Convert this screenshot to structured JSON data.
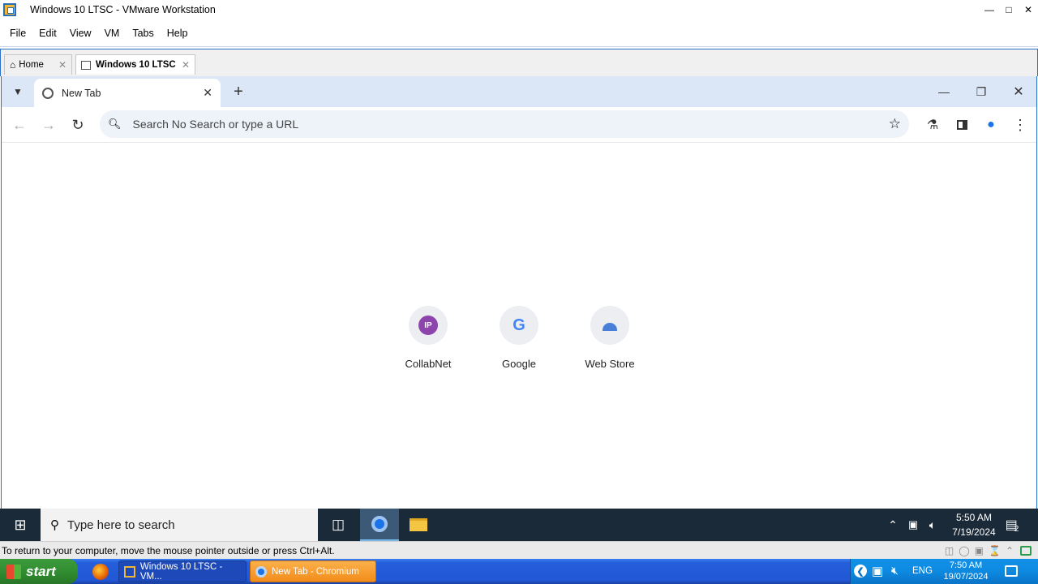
{
  "vmware": {
    "title": "Windows 10 LTSC - VMware Workstation",
    "menu": [
      "File",
      "Edit",
      "View",
      "VM",
      "Tabs",
      "Help"
    ],
    "tabs": [
      {
        "label": "Home"
      },
      {
        "label": "Windows 10 LTSC"
      }
    ],
    "status_text": "To return to your computer, move the mouse pointer outside or press Ctrl+Alt."
  },
  "chromium": {
    "tab_label": "New Tab",
    "omnibox_placeholder": "Search No Search or type a URL",
    "shortcuts": [
      {
        "name": "CollabNet",
        "badge": "IP",
        "badge_color": "#8e44ad"
      },
      {
        "name": "Google",
        "badge": "G"
      },
      {
        "name": "Web Store"
      }
    ]
  },
  "win10_taskbar": {
    "search_placeholder": "Type here to search",
    "time": "5:50 AM",
    "date": "7/19/2024",
    "notification_count": "2"
  },
  "xp_taskbar": {
    "start_label": "start",
    "tasks": [
      {
        "label": "Windows 10 LTSC - VM..."
      },
      {
        "label": "New Tab - Chromium"
      }
    ],
    "lang": "ENG",
    "time": "7:50 AM",
    "date": "19/07/2024"
  }
}
